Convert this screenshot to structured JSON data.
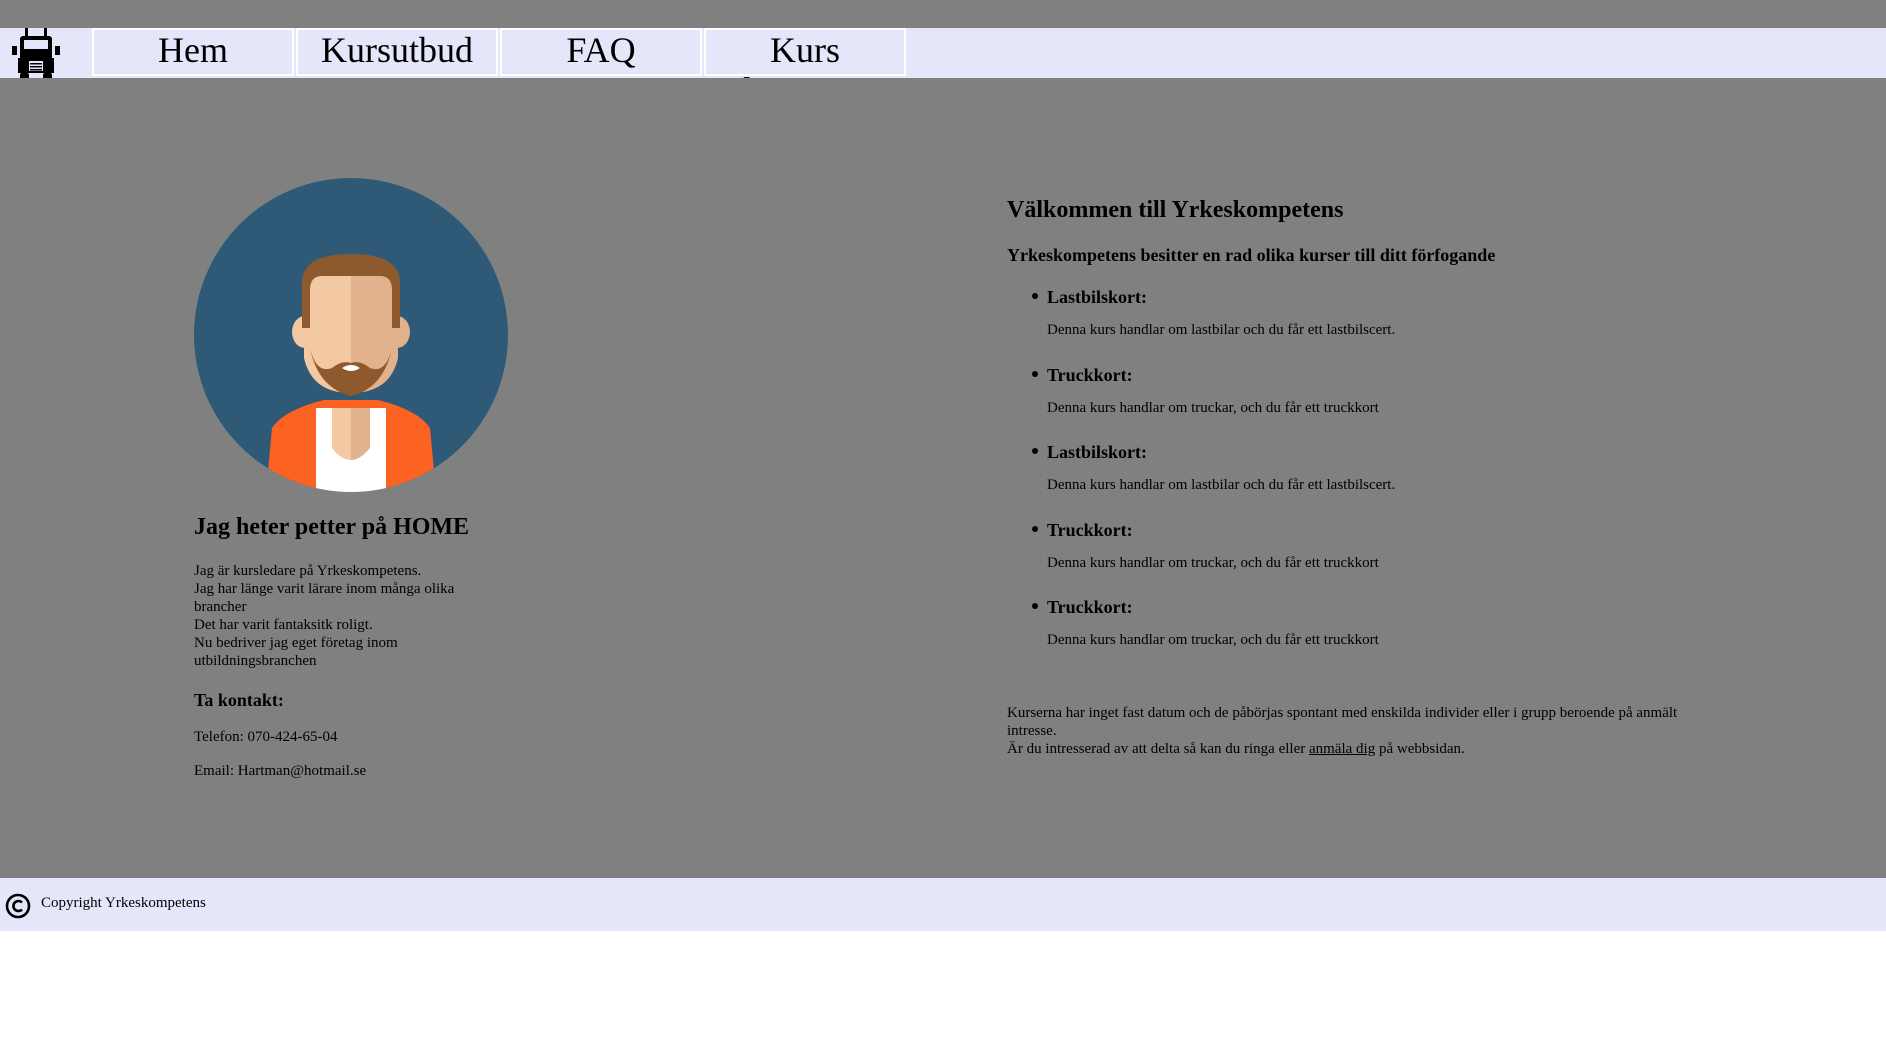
{
  "nav": {
    "items": [
      {
        "label": "Hem"
      },
      {
        "label": "Kursutbud"
      },
      {
        "label": "FAQ"
      },
      {
        "label": "Kurs litteratur"
      }
    ]
  },
  "profile": {
    "title": "Jag heter petter på HOME",
    "bio_lines": [
      "Jag är kursledare på Yrkeskompetens.",
      "Jag har länge varit lärare inom många olika brancher",
      "Det har varit fantaksitk roligt.",
      "Nu bedriver jag eget företag inom utbildningsbranchen"
    ],
    "contact_heading": "Ta kontakt:",
    "phone": "Telefon: 070-424-65-04",
    "email": "Email: Hartman@hotmail.se"
  },
  "welcome": {
    "heading": "Välkommen till Yrkeskompetens",
    "subheading": "Yrkeskompetens besitter en rad olika kurser till ditt förfogande",
    "courses": [
      {
        "title": "Lastbilskort:",
        "desc": "Denna kurs handlar om lastbilar och du får ett lastbilscert."
      },
      {
        "title": "Truckkort:",
        "desc": "Denna kurs handlar om truckar, och du får ett truckkort"
      },
      {
        "title": "Lastbilskort:",
        "desc": "Denna kurs handlar om lastbilar och du får ett lastbilscert."
      },
      {
        "title": "Truckkort:",
        "desc": "Denna kurs handlar om truckar, och du får ett truckkort"
      },
      {
        "title": "Truckkort:",
        "desc": "Denna kurs handlar om truckar, och du får ett truckkort"
      }
    ],
    "info_line1": "Kurserna har inget fast datum och de påbörjas spontant med enskilda individer eller i grupp beroende på anmält intresse.",
    "info_line2_before": "Är du intresserad av att delta så kan du ringa eller ",
    "info_link": "anmäla dig",
    "info_line2_after": " på webbsidan."
  },
  "footer": {
    "copyright": "Copyright Yrkeskompetens"
  },
  "colors": {
    "background_gray": "#808080",
    "nav_bg": "#e6e6fa",
    "avatar_bg": "#2e5a78",
    "jacket": "#fc6221",
    "hair": "#8e5a2d"
  },
  "icons": {
    "logo": "truck-icon",
    "copyright": "copyright-icon"
  }
}
